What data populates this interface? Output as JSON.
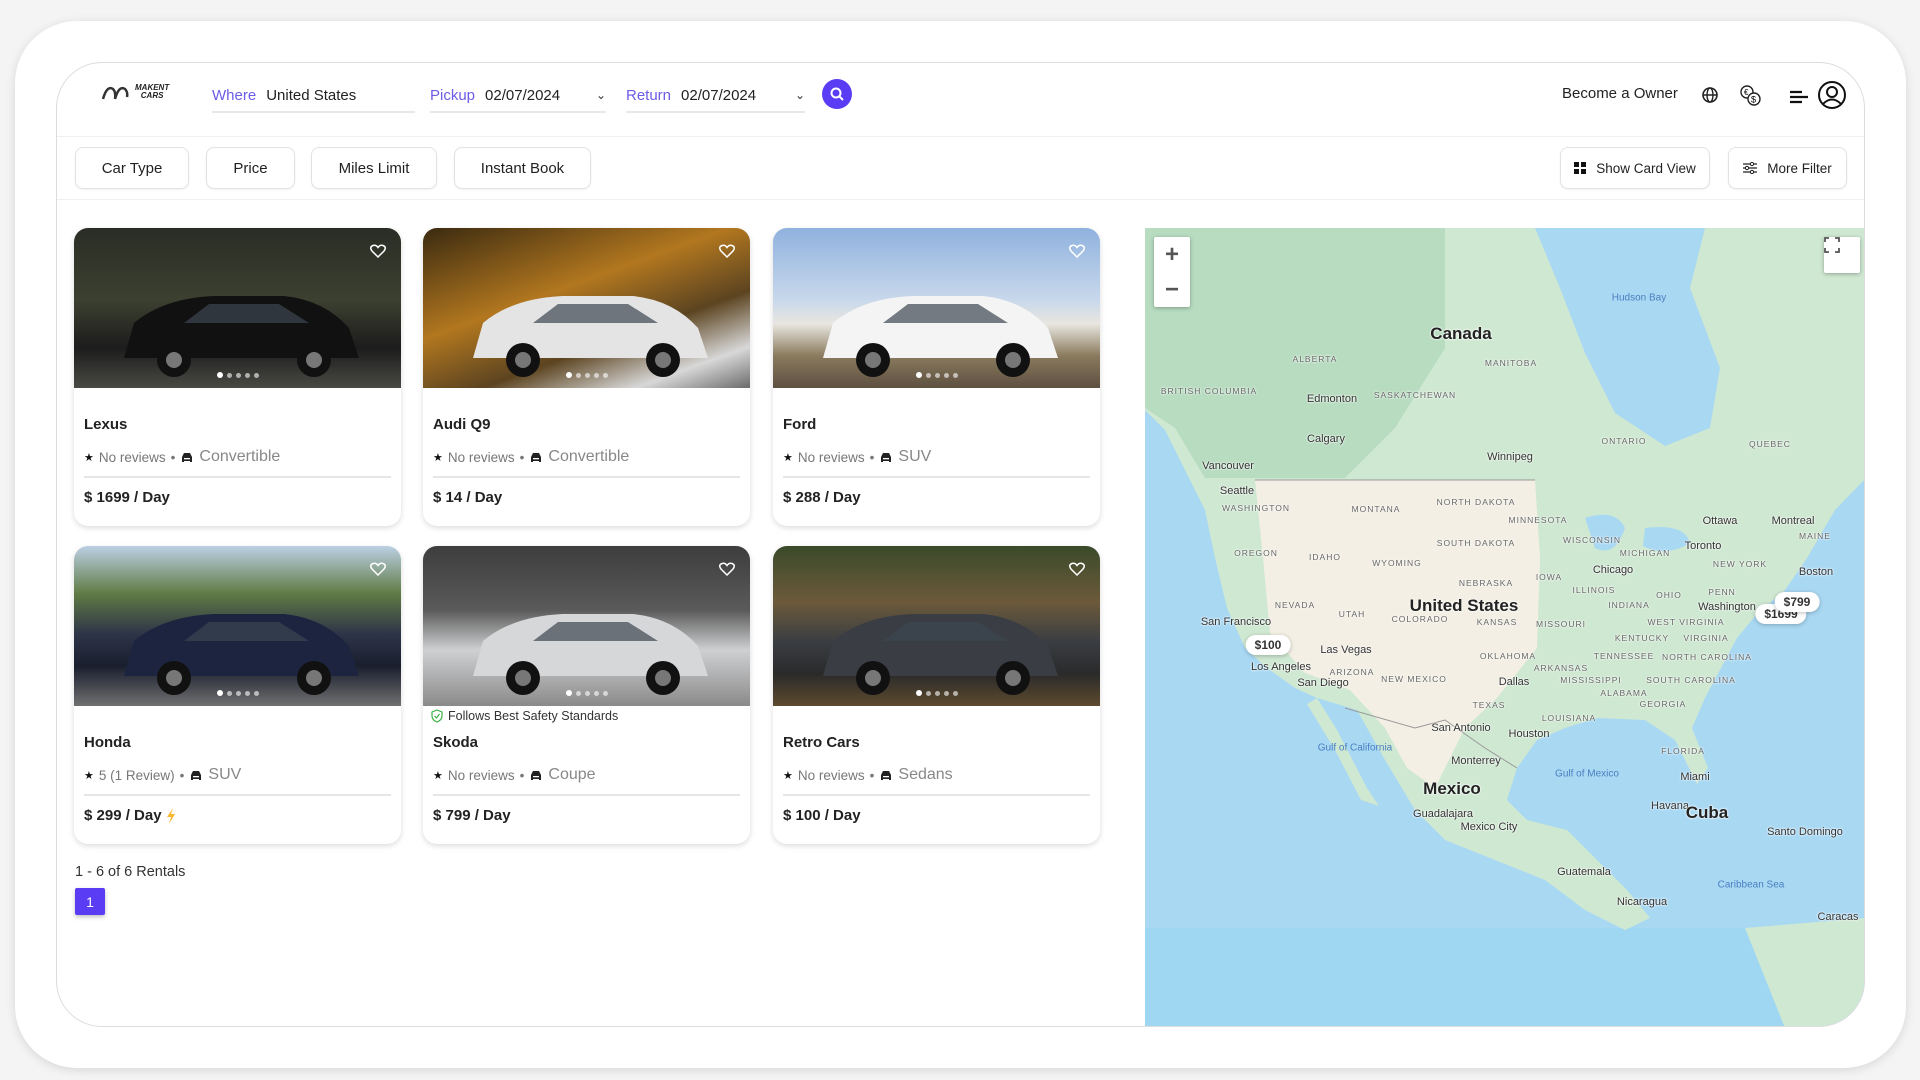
{
  "header": {
    "logo_text": "MAKENT CARS",
    "where_label": "Where",
    "where_value": "United States",
    "pickup_label": "Pickup",
    "pickup_value": "02/07/2024",
    "return_label": "Return",
    "return_value": "02/07/2024",
    "become_owner": "Become a Owner",
    "accent": "#5b3cf5"
  },
  "filters": {
    "items": [
      "Car Type",
      "Price",
      "Miles Limit",
      "Instant Book"
    ],
    "show_card_view": "Show Card View",
    "more_filter": "More Filter"
  },
  "cars": [
    {
      "name": "Lexus",
      "rating": "No reviews",
      "type": "Convertible",
      "price": "$ 1699 / Day",
      "instant": false,
      "safety": ""
    },
    {
      "name": "Audi Q9",
      "rating": "No reviews",
      "type": "Convertible",
      "price": "$ 14 / Day",
      "instant": false,
      "safety": ""
    },
    {
      "name": "Ford",
      "rating": "No reviews",
      "type": "SUV",
      "price": "$ 288 / Day",
      "instant": false,
      "safety": ""
    },
    {
      "name": "Honda",
      "rating": "5 (1 Review)",
      "type": "SUV",
      "price": "$ 299 / Day",
      "instant": true,
      "safety": ""
    },
    {
      "name": "Skoda",
      "rating": "No reviews",
      "type": "Coupe",
      "price": "$ 799 / Day",
      "instant": false,
      "safety": "Follows Best Safety Standards"
    },
    {
      "name": "Retro Cars",
      "rating": "No reviews",
      "type": "Sedans",
      "price": "$ 100 / Day",
      "instant": false,
      "safety": ""
    }
  ],
  "pagination": {
    "summary": "1 - 6 of 6 Rentals",
    "current_page": "1"
  },
  "map": {
    "countries": [
      "Canada",
      "United States",
      "Mexico"
    ],
    "water": [
      "Hudson Bay",
      "Gulf of Mexico",
      "Caribbean Sea",
      "Gulf of California"
    ],
    "cities": [
      "Vancouver",
      "Seattle",
      "San Francisco",
      "Los Angeles",
      "San Diego",
      "Las Vegas",
      "Edmonton",
      "Calgary",
      "Winnipeg",
      "Chicago",
      "Toronto",
      "Ottawa",
      "Montreal",
      "Boston",
      "Washington",
      "Dallas",
      "Houston",
      "San Antonio",
      "Monterrey",
      "Guadalajara",
      "Mexico City",
      "Miami",
      "Havana",
      "Cuba",
      "Guatemala",
      "Nicaragua",
      "Caracas",
      "Santo Domingo"
    ],
    "regions": [
      "ALBERTA",
      "MANITOBA",
      "SASKATCHEWAN",
      "BRITISH COLUMBIA",
      "ONTARIO",
      "QUEBEC",
      "WASHINGTON",
      "MONTANA",
      "NORTH DAKOTA",
      "MINNESOTA",
      "OREGON",
      "IDAHO",
      "WYOMING",
      "SOUTH DAKOTA",
      "WISCONSIN",
      "MICHIGAN",
      "NEW YORK",
      "IOWA",
      "NEBRASKA",
      "ILLINOIS",
      "OHIO",
      "INDIANA",
      "PENN",
      "NEVADA",
      "UTAH",
      "COLORADO",
      "KANSAS",
      "MISSOURI",
      "KENTUCKY",
      "VIRGINIA",
      "WEST VIRGINIA",
      "TENNESSEE",
      "NORTH CAROLINA",
      "OKLAHOMA",
      "ARKANSAS",
      "ARIZONA",
      "NEW MEXICO",
      "MISSISSIPPI",
      "SOUTH CAROLINA",
      "ALABAMA",
      "GEORGIA",
      "TEXAS",
      "LOUISIANA",
      "FLORIDA",
      "MAINE"
    ],
    "price_pins": [
      "$100",
      "$799",
      "$1699"
    ]
  }
}
